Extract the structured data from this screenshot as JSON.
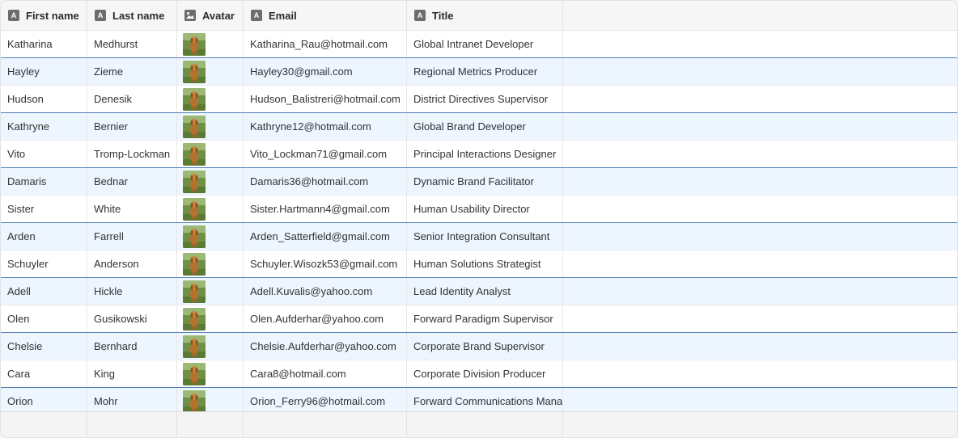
{
  "columns": [
    {
      "label": "First name",
      "icon": "text-type-icon"
    },
    {
      "label": "Last name",
      "icon": "text-type-icon"
    },
    {
      "label": "Avatar",
      "icon": "image-type-icon"
    },
    {
      "label": "Email",
      "icon": "text-type-icon"
    },
    {
      "label": "Title",
      "icon": "text-type-icon"
    }
  ],
  "rows": [
    {
      "first": "Katharina",
      "last": "Medhurst",
      "email": "Katharina_Rau@hotmail.com",
      "title": "Global Intranet Developer"
    },
    {
      "first": "Hayley",
      "last": "Zieme",
      "email": "Hayley30@gmail.com",
      "title": "Regional Metrics Producer"
    },
    {
      "first": "Hudson",
      "last": "Denesik",
      "email": "Hudson_Balistreri@hotmail.com",
      "title": "District Directives Supervisor"
    },
    {
      "first": "Kathryne",
      "last": "Bernier",
      "email": "Kathryne12@hotmail.com",
      "title": "Global Brand Developer"
    },
    {
      "first": "Vito",
      "last": "Tromp-Lockman",
      "email": "Vito_Lockman71@gmail.com",
      "title": "Principal Interactions Designer"
    },
    {
      "first": "Damaris",
      "last": "Bednar",
      "email": "Damaris36@hotmail.com",
      "title": "Dynamic Brand Facilitator"
    },
    {
      "first": "Sister",
      "last": "White",
      "email": "Sister.Hartmann4@gmail.com",
      "title": "Human Usability Director"
    },
    {
      "first": "Arden",
      "last": "Farrell",
      "email": "Arden_Satterfield@gmail.com",
      "title": "Senior Integration Consultant"
    },
    {
      "first": "Schuyler",
      "last": "Anderson",
      "email": "Schuyler.Wisozk53@gmail.com",
      "title": "Human Solutions Strategist"
    },
    {
      "first": "Adell",
      "last": "Hickle",
      "email": "Adell.Kuvalis@yahoo.com",
      "title": "Lead Identity Analyst"
    },
    {
      "first": "Olen",
      "last": "Gusikowski",
      "email": "Olen.Aufderhar@yahoo.com",
      "title": "Forward Paradigm Supervisor"
    },
    {
      "first": "Chelsie",
      "last": "Bernhard",
      "email": "Chelsie.Aufderhar@yahoo.com",
      "title": "Corporate Brand Supervisor"
    },
    {
      "first": "Cara",
      "last": "King",
      "email": "Cara8@hotmail.com",
      "title": "Corporate Division Producer"
    },
    {
      "first": "Orion",
      "last": "Mohr",
      "email": "Orion_Ferry96@hotmail.com",
      "title": "Forward Communications Manager"
    }
  ],
  "colors": {
    "alt_row_background": "#edf5ff",
    "alt_row_border": "#4f7fb9",
    "header_background": "#f6f6f6"
  }
}
